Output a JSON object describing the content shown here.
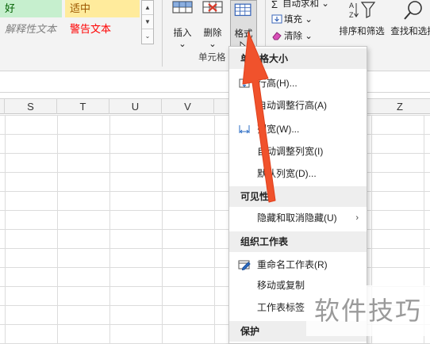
{
  "ribbon": {
    "styles": {
      "good": "好",
      "neutral": "适中",
      "explanatory": "解释性文本",
      "warning": "警告文本"
    },
    "cells": {
      "insert_label": "插入",
      "insert_caret": "⌄",
      "delete_label": "删除",
      "delete_caret": "⌄",
      "format_label": "格式",
      "group_label": "单元格"
    },
    "editing": {
      "autosum_label": "自动求和 ⌄",
      "fill_label": "填充 ⌄",
      "clear_label": "清除 ⌄",
      "sort_label": "排序和筛选",
      "find_label": "查找和选择"
    }
  },
  "sheet": {
    "columns": [
      "S",
      "T",
      "U",
      "V",
      "Z"
    ]
  },
  "format_menu": {
    "cell_size_header": "单元格大小",
    "row_height": "行高(H)...",
    "autofit_row_height": "自动调整行高(A)",
    "column_width": "列宽(W)...",
    "autofit_column_width": "自动调整列宽(I)",
    "default_width": "默认列宽(D)...",
    "visibility_header": "可见性",
    "hide_unhide": "隐藏和取消隐藏(U)",
    "organize_sheets_header": "组织工作表",
    "rename_sheet": "重命名工作表(R)",
    "move_copy": "移动或复制",
    "tab_color": "工作表标签",
    "protection_header": "保护"
  },
  "watermark": {
    "text": "软件技巧"
  },
  "colors": {
    "arrow": "#f0522c",
    "good_fill": "#c6efce",
    "neutral_fill": "#ffeb9c",
    "warning_text": "#ff0000"
  }
}
